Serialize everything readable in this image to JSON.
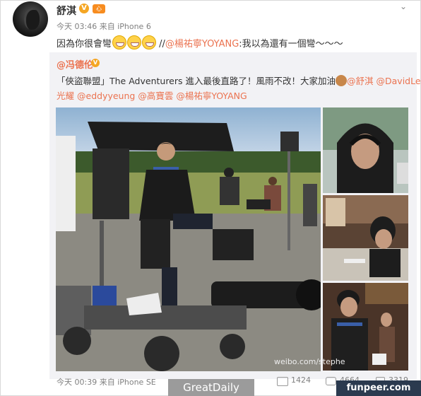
{
  "post": {
    "username": "舒淇",
    "v_badge": "V",
    "level_badge": "心",
    "menu_icon": "chevron-down-icon",
    "time": "今天 03:46",
    "source": "来自 iPhone 6",
    "text_before": "因為你很會彎",
    "text_sep": " //",
    "mention": "@楊祐寧YOYANG",
    "text_after": ":我以為還有一個彎～～～"
  },
  "repost": {
    "author": "@冯德伦",
    "v_badge": "V",
    "line1_prefix": "「俠盜聯盟」The Adventurers 進入最後直路了！風雨不改！大家加油",
    "mention_shuqi": "@舒淇",
    "mention_davidlee": "@DavidLee",
    "line2_cont": "光耀",
    "mention_eddy": "@eddyyeung",
    "mention_gao": "@高寶雲",
    "mention_yoyang": "@楊祐寧YOYANG",
    "watermark": "weibo.com/stephe",
    "time": "今天 00:39",
    "source": "来自 iPhone SE",
    "shares": "1424",
    "comments": "4664",
    "likes": "3319"
  },
  "overlays": {
    "greatdaily": "GreatDaily",
    "funpeer": "funpeer.com"
  },
  "colors": {
    "link": "#eb7350",
    "repost_bg": "#f2f2f5",
    "meta": "#808080"
  }
}
